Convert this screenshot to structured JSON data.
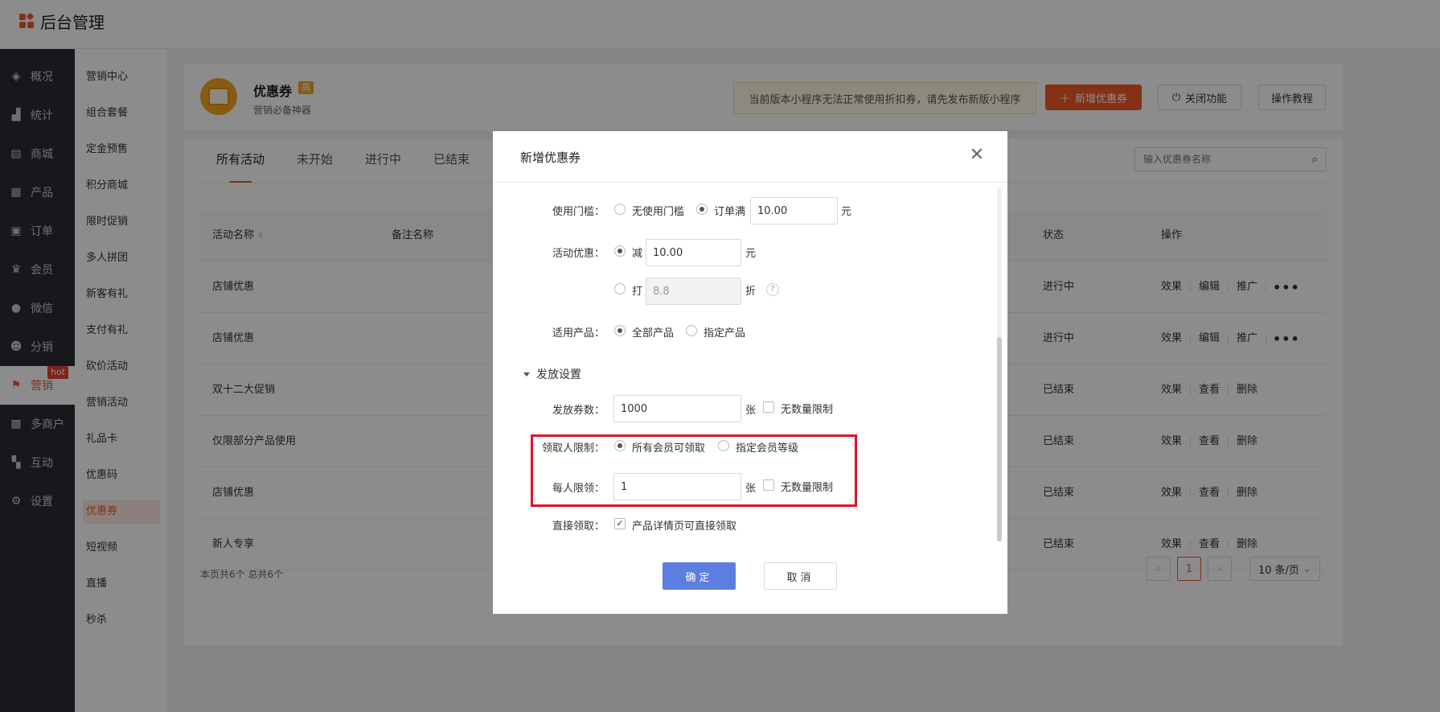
{
  "app": {
    "title": "后台管理"
  },
  "sidebar_primary": {
    "items": [
      {
        "label": "概况",
        "icon": "layers-icon"
      },
      {
        "label": "统计",
        "icon": "chart-icon"
      },
      {
        "label": "商城",
        "icon": "shop-icon"
      },
      {
        "label": "产品",
        "icon": "grid-icon"
      },
      {
        "label": "订单",
        "icon": "order-icon"
      },
      {
        "label": "会员",
        "icon": "crown-icon"
      },
      {
        "label": "微信",
        "icon": "wechat-icon"
      },
      {
        "label": "分销",
        "icon": "people-icon"
      },
      {
        "label": "营销",
        "icon": "flag-icon",
        "badge": "hot"
      },
      {
        "label": "多商户",
        "icon": "merchant-icon"
      },
      {
        "label": "互动",
        "icon": "apps-icon"
      },
      {
        "label": "设置",
        "icon": "gear-icon"
      }
    ]
  },
  "sidebar_secondary": {
    "items": [
      "营销中心",
      "组合套餐",
      "定金预售",
      "积分商城",
      "限时促销",
      "多人拼团",
      "新客有礼",
      "支付有礼",
      "砍价活动",
      "营销活动",
      "礼品卡",
      "优惠码",
      "优惠券",
      "短视频",
      "直播",
      "秒杀"
    ]
  },
  "header": {
    "title": "优惠券",
    "badge": "高",
    "subtitle": "营销必备神器",
    "notice": "当前版本小程序无法正常使用折扣券，请先发布新版小程序",
    "add_button": "新增优惠券",
    "close_button": "关闭功能",
    "tutorial_button": "操作教程"
  },
  "tabs": [
    "所有活动",
    "未开始",
    "进行中",
    "已结束"
  ],
  "search": {
    "placeholder": "输入优惠券名称"
  },
  "table": {
    "columns": {
      "name": "活动名称",
      "remark": "备注名称",
      "status": "状态",
      "ops": "操作"
    },
    "rows": [
      {
        "name": "店铺优惠",
        "status": "进行中",
        "ops": [
          "效果",
          "编辑",
          "推广"
        ],
        "more": "•••"
      },
      {
        "name": "店铺优惠",
        "status": "进行中",
        "ops": [
          "效果",
          "编辑",
          "推广"
        ],
        "more": "•••"
      },
      {
        "name": "双十二大促销",
        "status": "已结束",
        "ops": [
          "效果",
          "查看",
          "删除"
        ]
      },
      {
        "name": "仅限部分产品使用",
        "status": "已结束",
        "ops": [
          "效果",
          "查看",
          "删除"
        ]
      },
      {
        "name": "店铺优惠",
        "status": "已结束",
        "ops": [
          "效果",
          "查看",
          "删除"
        ]
      },
      {
        "name": "新人专享",
        "status": "已结束",
        "ops": [
          "效果",
          "查看",
          "删除"
        ]
      }
    ]
  },
  "footer": {
    "info": "本页共6个 总共6个",
    "current_page": "1",
    "page_size": "10 条/页"
  },
  "modal": {
    "title": "新增优惠券",
    "threshold": {
      "label": "使用门槛：",
      "opt_none": "无使用门槛",
      "opt_order": "订单满",
      "value": "10.00",
      "unit": "元"
    },
    "discount": {
      "label": "活动优惠：",
      "opt_reduce": "减",
      "reduce_value": "10.00",
      "reduce_unit": "元",
      "opt_percent": "打",
      "percent_value": "8.8",
      "percent_unit": "折",
      "help": "?"
    },
    "products": {
      "label": "适用产品：",
      "opt_all": "全部产品",
      "opt_specific": "指定产品"
    },
    "section": "发放设置",
    "quantity": {
      "label": "发放券数：",
      "value": "1000",
      "unit": "张",
      "unlimited": "无数量限制"
    },
    "claimer": {
      "label": "领取人限制：",
      "opt_all": "所有会员可领取",
      "opt_level": "指定会员等级"
    },
    "per_person": {
      "label": "每人限领：",
      "value": "1",
      "unit": "张",
      "unlimited": "无数量限制"
    },
    "direct": {
      "label": "直接领取：",
      "option": "产品详情页可直接领取"
    },
    "ok": "确定",
    "cancel": "取消"
  }
}
